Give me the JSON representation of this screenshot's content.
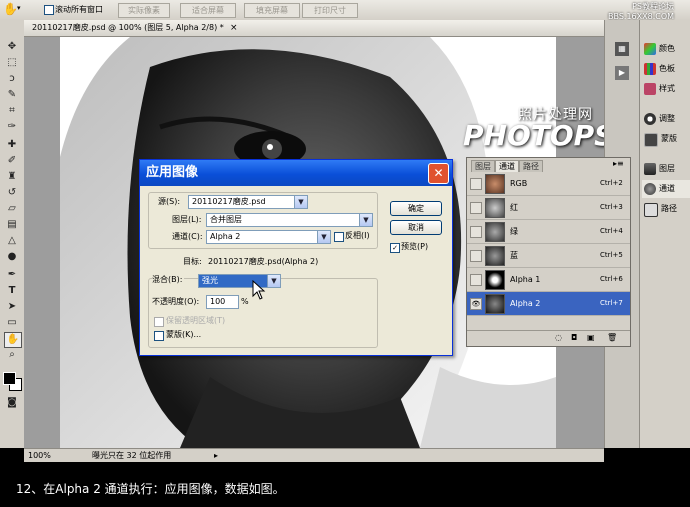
{
  "options_bar": {
    "scroll_all_windows": "滚动所有窗口",
    "buttons": [
      "实际像素",
      "适合屏幕",
      "填充屏幕",
      "打印尺寸"
    ]
  },
  "site_watermark": {
    "line1": "PS教程论坛",
    "line2": "BBS.16XX8.COM"
  },
  "document": {
    "tab_title": "20110217磨皮.psd @ 100% (图层 5, Alpha 2/8) *",
    "zoom": "100%",
    "status": "曝光只在 32 位起作用"
  },
  "watermark": {
    "line1": "照片处理网",
    "line2": "PHOTOPS.COM"
  },
  "dock": {
    "items": [
      {
        "label": "颜色",
        "icon": "color-icon"
      },
      {
        "label": "色板",
        "icon": "swatches-icon"
      },
      {
        "label": "样式",
        "icon": "styles-icon"
      },
      {
        "label": "调整",
        "icon": "adjustments-icon"
      },
      {
        "label": "蒙版",
        "icon": "masks-icon"
      },
      {
        "label": "图层",
        "icon": "layers-icon"
      },
      {
        "label": "通道",
        "icon": "channels-icon"
      },
      {
        "label": "路径",
        "icon": "paths-icon"
      }
    ]
  },
  "channels_panel": {
    "tabs": [
      "图层",
      "通道",
      "路径"
    ],
    "rows": [
      {
        "name": "RGB",
        "shortcut": "Ctrl+2"
      },
      {
        "name": "红",
        "shortcut": "Ctrl+3"
      },
      {
        "name": "绿",
        "shortcut": "Ctrl+4"
      },
      {
        "name": "蓝",
        "shortcut": "Ctrl+5"
      },
      {
        "name": "Alpha 1",
        "shortcut": "Ctrl+6"
      },
      {
        "name": "Alpha 2",
        "shortcut": "Ctrl+7"
      }
    ]
  },
  "dialog": {
    "title": "应用图像",
    "source_label": "源(S):",
    "source_value": "20110217磨皮.psd",
    "layer_label": "图层(L):",
    "layer_value": "合并图层",
    "channel_label": "通道(C):",
    "channel_value": "Alpha 2",
    "invert_label": "反相(I)",
    "target_label": "目标:",
    "target_value": "20110217磨皮.psd(Alpha 2)",
    "blending_label": "混合(B):",
    "blending_value": "强光",
    "opacity_label": "不透明度(O):",
    "opacity_value": "100",
    "opacity_unit": "%",
    "preserve_transparency_label": "保留透明区域(T)",
    "mask_label": "蒙版(K)...",
    "ok_label": "确定",
    "cancel_label": "取消",
    "preview_label": "预览(P)"
  },
  "caption": "12、在Alpha 2 通道执行：应用图像，数据如图。",
  "colors": {
    "title_bar": "#0a4fd8",
    "selection": "#3a64c0",
    "dialog_bg": "#ece9d8"
  }
}
